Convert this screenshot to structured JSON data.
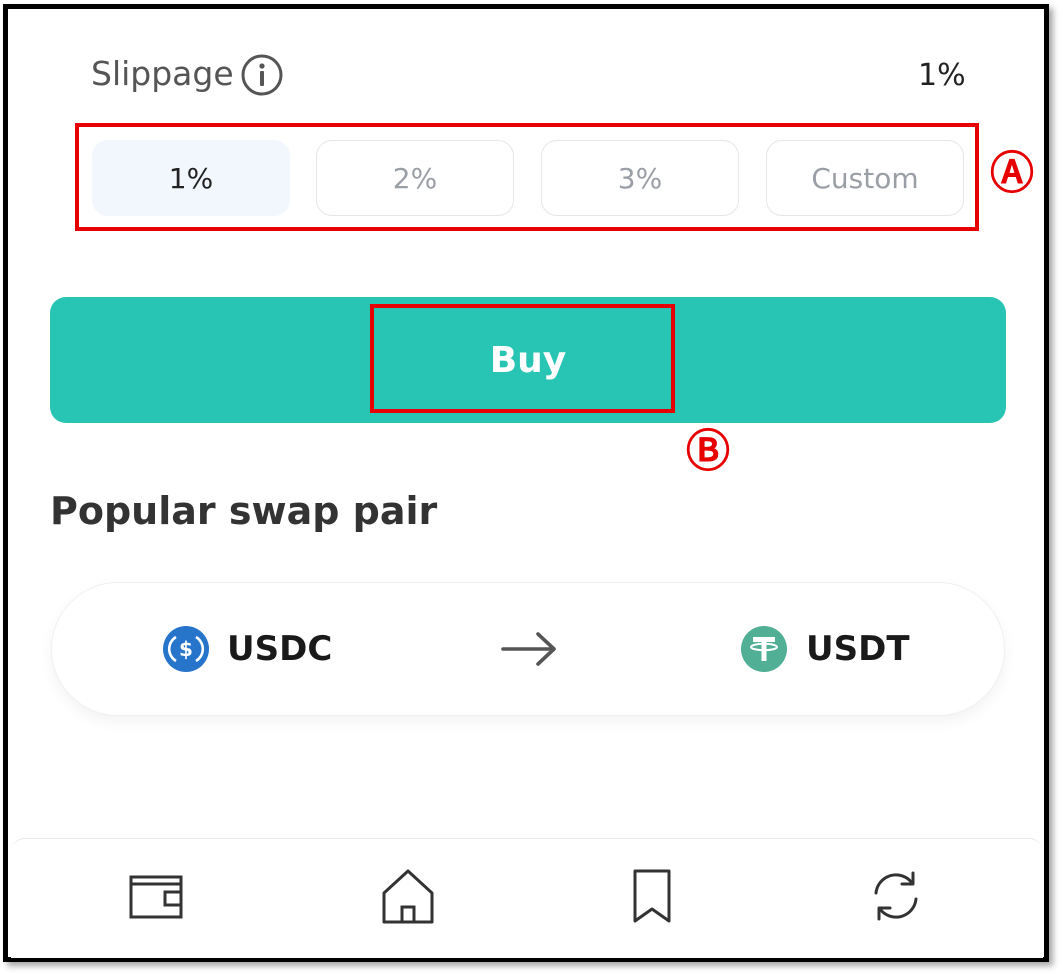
{
  "slippage": {
    "label": "Slippage",
    "value": "1%",
    "info_icon": "info-icon",
    "options": [
      {
        "label": "1%",
        "selected": true
      },
      {
        "label": "2%",
        "selected": false
      },
      {
        "label": "3%",
        "selected": false
      },
      {
        "label": "Custom",
        "selected": false
      }
    ]
  },
  "annotations": {
    "a": "Ⓐ",
    "b": "Ⓑ",
    "highlight_color": "#e60000"
  },
  "buy_button": {
    "label": "Buy",
    "color": "#28c4b4"
  },
  "popular": {
    "title": "Popular swap pair",
    "pair": {
      "from": {
        "symbol": "USDC",
        "icon": "usdc-icon",
        "color": "#2775ca"
      },
      "arrow_icon": "arrow-right-icon",
      "to": {
        "symbol": "USDT",
        "icon": "usdt-icon",
        "color": "#50af95"
      }
    }
  },
  "bottom_nav": {
    "items": [
      {
        "icon": "wallet-icon"
      },
      {
        "icon": "home-icon"
      },
      {
        "icon": "bookmark-icon"
      },
      {
        "icon": "swap-icon"
      }
    ]
  }
}
